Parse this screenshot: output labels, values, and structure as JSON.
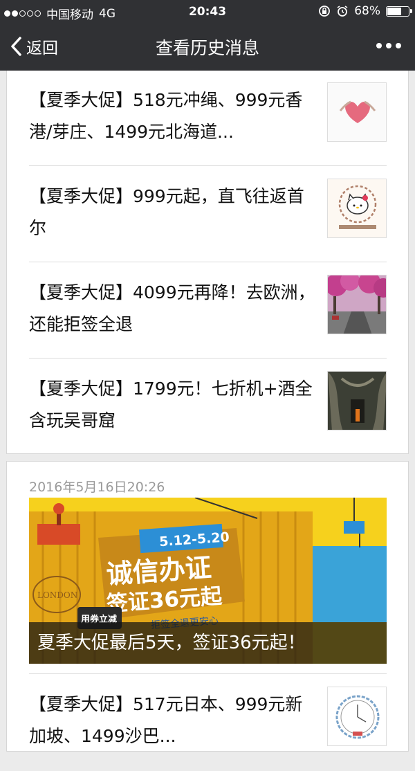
{
  "status_bar": {
    "carrier": "中国移动",
    "network": "4G",
    "time": "20:43",
    "battery": "68%",
    "battery_level": 0.68
  },
  "nav": {
    "back_label": "返回",
    "title": "查看历史消息"
  },
  "articles_top": [
    {
      "title": "【夏季大促】518元冲绳、999元香港/芽庄、1499元北海道...",
      "thumb": "heart-hands"
    },
    {
      "title": "【夏季大促】999元起，直飞往返首尔",
      "thumb": "hello-kitty-cafe"
    },
    {
      "title": "【夏季大促】4099元再降！去欧洲，还能拒签全退",
      "thumb": "blossom-street"
    },
    {
      "title": "【夏季大促】1799元！七折机+酒全含玩吴哥窟",
      "thumb": "temple-ruins"
    }
  ],
  "group2": {
    "date": "2016年5月16日20:26",
    "banner": {
      "caption": "夏季大促最后5天，签证36元起！",
      "dates": "5.12-5.20",
      "headline1": "诚信办证",
      "headline2": "签证36元起",
      "sub": "拒签全退更安心",
      "coupon": "用券立减",
      "london": "LONDON"
    },
    "articles": [
      {
        "title": "【夏季大促】517元日本、999元新加坡、1499沙巴...",
        "thumb": "clock-ring"
      }
    ]
  },
  "colors": {
    "nav_bg": "#303134",
    "page_bg": "#ebebeb",
    "banner_yellow": "#f7cf1d",
    "date_gray": "#9a9a9a"
  }
}
